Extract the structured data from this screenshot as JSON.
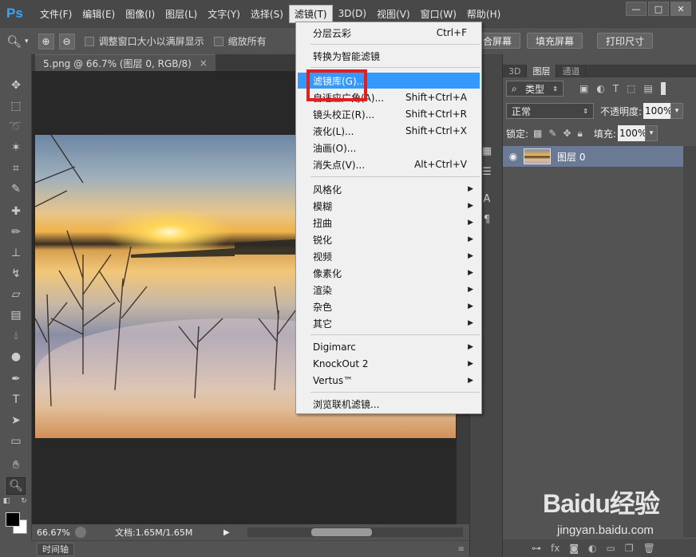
{
  "app": {
    "logo": "Ps"
  },
  "menubar": {
    "items": [
      "文件(F)",
      "编辑(E)",
      "图像(I)",
      "图层(L)",
      "文字(Y)",
      "选择(S)",
      "滤镜(T)",
      "3D(D)",
      "视图(V)",
      "窗口(W)",
      "帮助(H)"
    ],
    "active_index": 6
  },
  "window_controls": {
    "minimize": "—",
    "restore": "□",
    "close": "✕"
  },
  "options_bar": {
    "resize_windows_label": "调整窗口大小以满屏显示",
    "zoom_all_label": "缩放所有",
    "fit_screen_button": "合屏幕",
    "fill_screen_button": "填充屏幕",
    "print_size_button": "打印尺寸"
  },
  "document": {
    "tab_title": "5.png @ 66.7% (图层 0, RGB/8)",
    "tab_close": "×"
  },
  "status_bar": {
    "zoom": "66.67%",
    "doc_info": "文档:1.65M/1.65M"
  },
  "timeline": {
    "label": "时间轴"
  },
  "filter_menu": {
    "groups": [
      [
        {
          "label": "分层云彩",
          "shortcut": "Ctrl+F"
        }
      ],
      [
        {
          "label": "转换为智能滤镜",
          "shortcut": ""
        }
      ],
      [
        {
          "label": "滤镜库(G)...",
          "shortcut": "",
          "highlight": true
        },
        {
          "label": "自适应广角(A)...",
          "shortcut": "Shift+Ctrl+A"
        },
        {
          "label": "镜头校正(R)...",
          "shortcut": "Shift+Ctrl+R"
        },
        {
          "label": "液化(L)...",
          "shortcut": "Shift+Ctrl+X"
        },
        {
          "label": "油画(O)...",
          "shortcut": ""
        },
        {
          "label": "消失点(V)...",
          "shortcut": "Alt+Ctrl+V"
        }
      ],
      [
        {
          "label": "风格化",
          "submenu": true
        },
        {
          "label": "模糊",
          "submenu": true
        },
        {
          "label": "扭曲",
          "submenu": true
        },
        {
          "label": "锐化",
          "submenu": true
        },
        {
          "label": "视频",
          "submenu": true
        },
        {
          "label": "像素化",
          "submenu": true
        },
        {
          "label": "渲染",
          "submenu": true
        },
        {
          "label": "杂色",
          "submenu": true
        },
        {
          "label": "其它",
          "submenu": true
        }
      ],
      [
        {
          "label": "Digimarc",
          "submenu": true
        },
        {
          "label": "KnockOut 2",
          "submenu": true
        },
        {
          "label": "Vertus™",
          "submenu": true
        }
      ],
      [
        {
          "label": "浏览联机滤镜...",
          "shortcut": ""
        }
      ]
    ]
  },
  "layers_panel": {
    "tabs": [
      "3D",
      "图层",
      "通道"
    ],
    "active_tab": 1,
    "filter_kind": "类型",
    "blend_mode": "正常",
    "opacity_label": "不透明度:",
    "opacity_value": "100%",
    "lock_label": "锁定:",
    "fill_label": "填充:",
    "fill_value": "100%",
    "layers": [
      {
        "name": "图层 0",
        "visible": true
      }
    ]
  },
  "watermark": {
    "logo": "Baidu经验",
    "url": "jingyan.baidu.com"
  },
  "colors": {
    "highlight": "#3399ff",
    "red_box": "#e02020",
    "ps_logo": "#31a8ff",
    "selected_layer": "#6a7a95"
  }
}
